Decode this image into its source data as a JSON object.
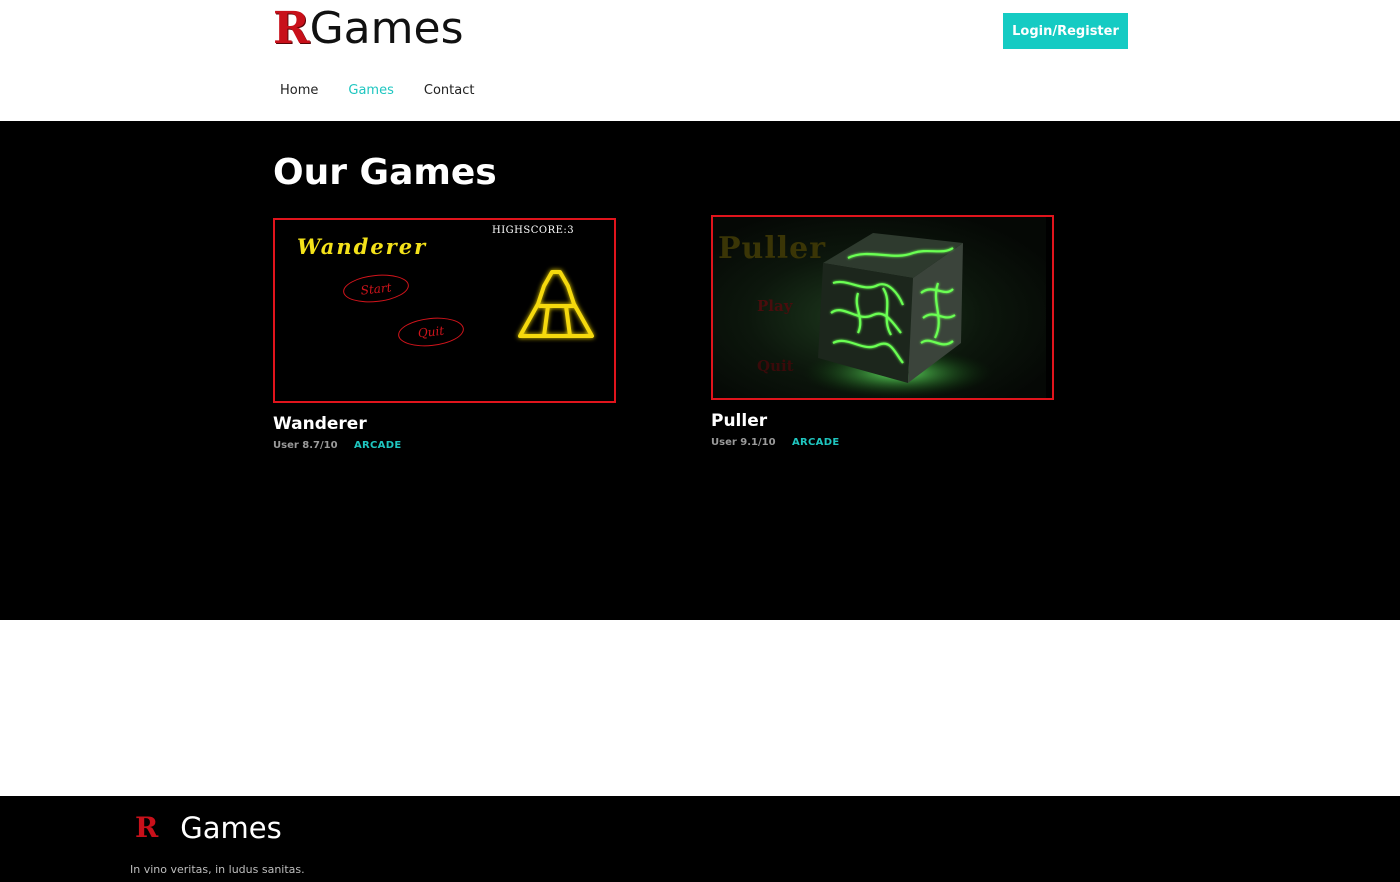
{
  "header": {
    "logo_mark": "R",
    "logo_text": "Games",
    "login_label": "Login/Register",
    "accent_color": "#15cbc3",
    "brand_color": "#c8101a"
  },
  "nav": {
    "items": [
      {
        "label": "Home",
        "active": false
      },
      {
        "label": "Games",
        "active": true
      },
      {
        "label": "Contact",
        "active": false
      }
    ]
  },
  "main": {
    "title": "Our Games",
    "games": [
      {
        "title": "Wanderer",
        "rating": "User 8.7/10",
        "genre": "ARCADE",
        "thumbnail": {
          "game_title": "Wanderer",
          "highscore": "HIGHSCORE:3",
          "start": "Start",
          "quit": "Quit",
          "icon": "bell-icon"
        }
      },
      {
        "title": "Puller",
        "rating": "User 9.1/10",
        "genre": "ARCADE",
        "thumbnail": {
          "game_title": "Puller",
          "play": "Play",
          "quit": "Quit",
          "icon": "glowing-cube-icon"
        }
      }
    ]
  },
  "footer": {
    "logo_mark": "R",
    "logo_text": "Games",
    "tagline": "In vino veritas, in ludus sanitas."
  }
}
